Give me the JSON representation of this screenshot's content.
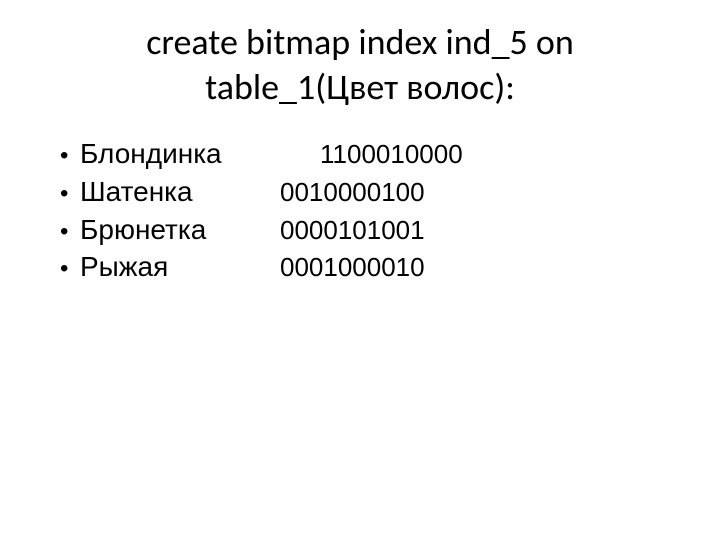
{
  "slide": {
    "title": "create bitmap index ind_5 on table_1(Цвет волос):",
    "items": [
      {
        "label": "Блондинка",
        "code": "1100010000",
        "wide": true
      },
      {
        "label": "Шатенка",
        "code": "0010000100",
        "wide": false
      },
      {
        "label": "Брюнетка",
        "code": "0000101001",
        "wide": false
      },
      {
        "label": "Рыжая",
        "code": "0001000010",
        "wide": false
      }
    ]
  }
}
